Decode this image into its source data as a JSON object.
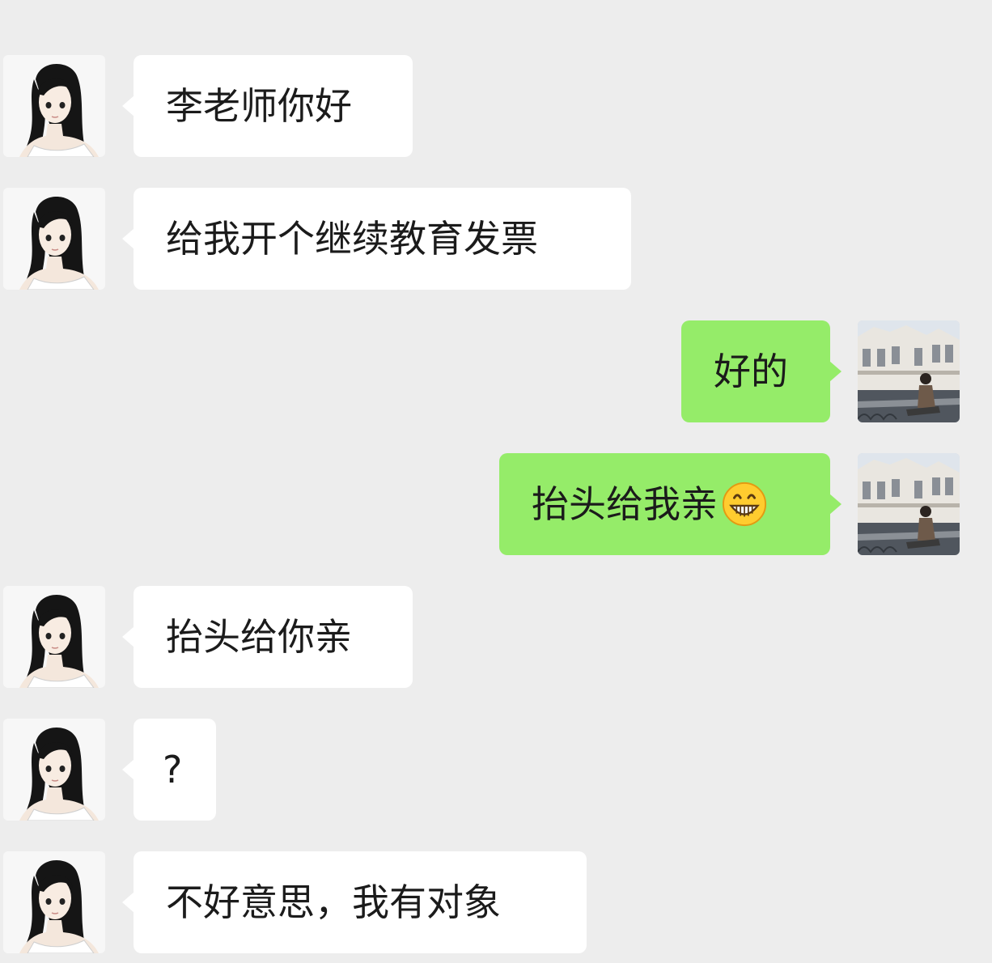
{
  "colors": {
    "background": "#ededed",
    "incoming_bubble": "#ffffff",
    "outgoing_bubble": "#95ec69",
    "text": "#1b1b1b"
  },
  "messages": [
    {
      "side": "left",
      "text": "李老师你好",
      "avatar": "girl-illustration-avatar"
    },
    {
      "side": "left",
      "text": "给我开个继续教育发票",
      "avatar": "girl-illustration-avatar"
    },
    {
      "side": "right",
      "text": "好的",
      "avatar": "building-photo-avatar"
    },
    {
      "side": "right",
      "text": "抬头给我亲",
      "emoji": "grinning-face-emoji",
      "avatar": "building-photo-avatar"
    },
    {
      "side": "left",
      "text": "抬头给你亲",
      "avatar": "girl-illustration-avatar"
    },
    {
      "side": "left",
      "text": "?",
      "avatar": "girl-illustration-avatar"
    },
    {
      "side": "left",
      "text": "不好意思，我有对象",
      "avatar": "girl-illustration-avatar"
    }
  ]
}
